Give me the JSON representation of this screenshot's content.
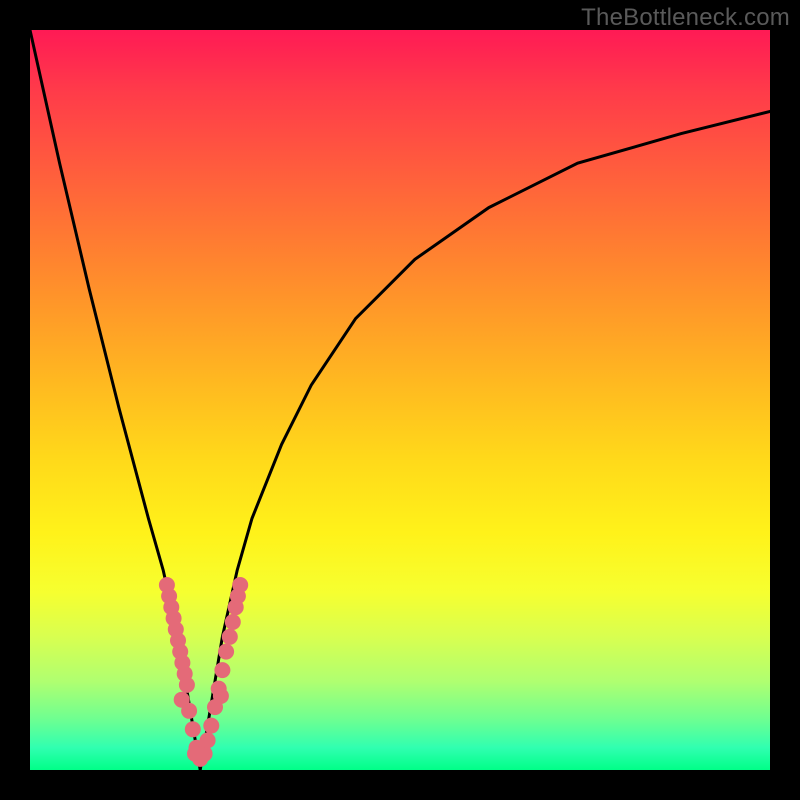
{
  "watermark": "TheBottleneck.com",
  "accent_color": "#e46a78",
  "curve_color": "#000000",
  "background_gradient": {
    "top": "#ff1a55",
    "mid": "#ffd91a",
    "bottom": "#00ff88"
  },
  "chart_data": {
    "type": "line",
    "title": "",
    "xlabel": "",
    "ylabel": "",
    "xlim": [
      0,
      100
    ],
    "ylim": [
      0,
      100
    ],
    "grid": false,
    "legend": false,
    "notch_x": 23,
    "series": [
      {
        "name": "bottleneck-curve",
        "x": [
          0,
          4,
          8,
          12,
          16,
          18,
          20,
          21,
          22,
          23,
          24,
          25,
          26,
          28,
          30,
          34,
          38,
          44,
          52,
          62,
          74,
          88,
          100
        ],
        "y": [
          100,
          82,
          65,
          49,
          34,
          27,
          18,
          12,
          6,
          0,
          6,
          12,
          18,
          27,
          34,
          44,
          52,
          61,
          69,
          76,
          82,
          86,
          89
        ]
      }
    ],
    "highlight_points": {
      "name": "pink-dots",
      "color": "#e46a78",
      "points": [
        {
          "x": 18.5,
          "y": 25
        },
        {
          "x": 18.8,
          "y": 23.5
        },
        {
          "x": 19.1,
          "y": 22
        },
        {
          "x": 19.4,
          "y": 20.5
        },
        {
          "x": 19.7,
          "y": 19
        },
        {
          "x": 20,
          "y": 17.5
        },
        {
          "x": 20.3,
          "y": 16
        },
        {
          "x": 20.6,
          "y": 14.5
        },
        {
          "x": 20.9,
          "y": 13
        },
        {
          "x": 21.2,
          "y": 11.5
        },
        {
          "x": 20.5,
          "y": 9.5
        },
        {
          "x": 21.5,
          "y": 8
        },
        {
          "x": 22,
          "y": 5.5
        },
        {
          "x": 22.5,
          "y": 3
        },
        {
          "x": 23,
          "y": 1.5
        },
        {
          "x": 22.3,
          "y": 2.2
        },
        {
          "x": 23.6,
          "y": 2.2
        },
        {
          "x": 24,
          "y": 4
        },
        {
          "x": 24.5,
          "y": 6
        },
        {
          "x": 25,
          "y": 8.5
        },
        {
          "x": 25.5,
          "y": 11
        },
        {
          "x": 26,
          "y": 13.5
        },
        {
          "x": 26.5,
          "y": 16
        },
        {
          "x": 25.8,
          "y": 10
        },
        {
          "x": 27,
          "y": 18
        },
        {
          "x": 27.4,
          "y": 20
        },
        {
          "x": 27.8,
          "y": 22
        },
        {
          "x": 28.1,
          "y": 23.5
        },
        {
          "x": 28.4,
          "y": 25
        }
      ]
    }
  }
}
